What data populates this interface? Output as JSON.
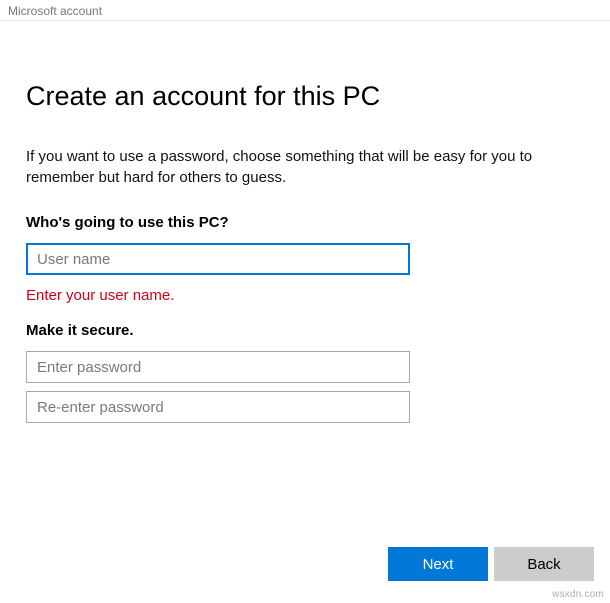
{
  "window": {
    "title": "Microsoft account"
  },
  "main": {
    "heading": "Create an account for this PC",
    "description": "If you want to use a password, choose something that will be easy for you to remember but hard for others to guess.",
    "user_section": {
      "label": "Who's going to use this PC?",
      "username_placeholder": "User name",
      "username_value": "",
      "error": "Enter your user name."
    },
    "password_section": {
      "label": "Make it secure.",
      "password_placeholder": "Enter password",
      "password_value": "",
      "confirm_placeholder": "Re-enter password",
      "confirm_value": ""
    }
  },
  "buttons": {
    "next": "Next",
    "back": "Back"
  },
  "watermark": "wsxdn.com"
}
